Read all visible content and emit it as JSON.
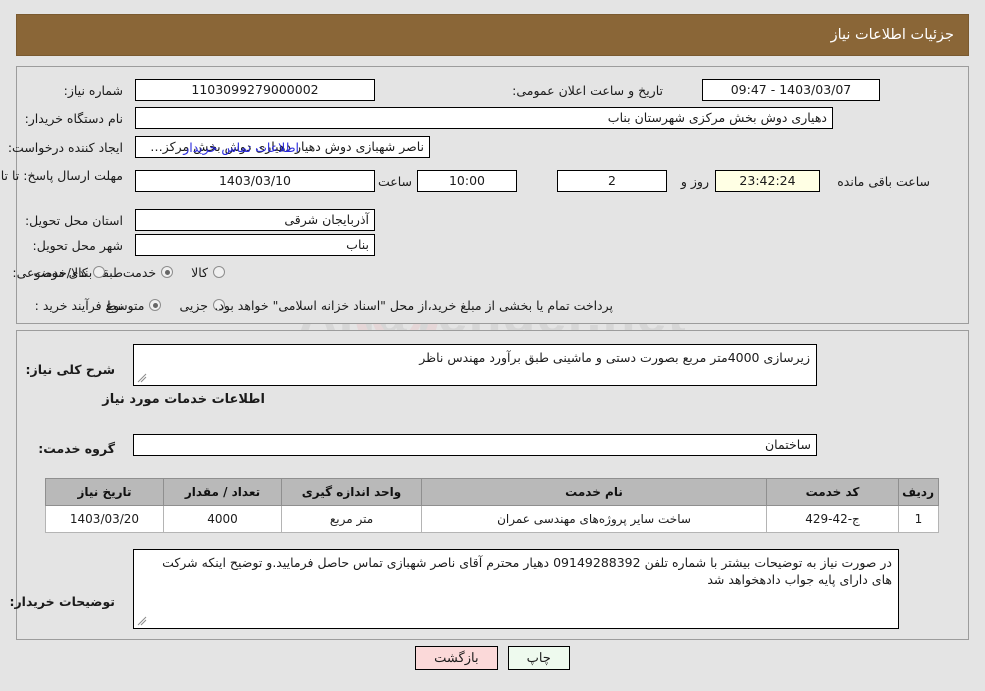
{
  "header": {
    "title": "جزئیات اطلاعات نیاز"
  },
  "watermark": {
    "text": "AriaTender.net",
    "shield_icon": "shield-icon"
  },
  "info": {
    "need_number_label": "شماره نیاز:",
    "need_number_value": "1103099279000002",
    "announce_datetime_label": "تاریخ و ساعت اعلان عمومی:",
    "announce_datetime_value": "1403/03/07 - 09:47",
    "buyer_org_label": "نام دستگاه خریدار:",
    "buyer_org_value": "دهیاری دوش بخش مرکزی شهرستان بناب",
    "requester_label": "ایجاد کننده درخواست:",
    "requester_value": "ناصر شهبازی دوش دهیار دهیاری دوش بخش مرکزی شهرستان بناب",
    "contact_link": "اطلاعات تماس خریدار",
    "deadline_label": "مهلت ارسال پاسخ: تا تاریخ:",
    "deadline_date": "1403/03/10",
    "deadline_hour_label": "ساعت",
    "deadline_hour": "10:00",
    "days_remaining": "2",
    "days_and_label": "روز و",
    "countdown": "23:42:24",
    "remaining_label": "ساعت باقی مانده",
    "province_label": "استان محل تحویل:",
    "province_value": "آذربایجان شرقی",
    "city_label": "شهر محل تحویل:",
    "city_value": "بناب",
    "category_label": "طبقه بندی موضوعی:",
    "category_options": [
      {
        "label": "کالا",
        "selected": false
      },
      {
        "label": "خدمت",
        "selected": true
      },
      {
        "label": "کالا/خدمت",
        "selected": false
      }
    ],
    "process_label": "نوع فرآیند خرید :",
    "process_options": [
      {
        "label": "جزیی",
        "selected": false
      },
      {
        "label": "متوسط",
        "selected": true
      }
    ],
    "process_note": "پرداخت تمام یا بخشی از مبلغ خرید،از محل \"اسناد خزانه اسلامی\" خواهد بود."
  },
  "description": {
    "label": "شرح کلی نیاز:",
    "value": "زیرسازی 4000متر مربع بصورت دستی و ماشینی طبق برآورد مهندس ناظر"
  },
  "services_section": {
    "heading": "اطلاعات خدمات مورد نیاز",
    "group_label": "گروه خدمت:",
    "group_value": "ساختمان"
  },
  "table": {
    "columns": [
      "ردیف",
      "کد خدمت",
      "نام خدمت",
      "واحد اندازه گیری",
      "تعداد / مقدار",
      "تاریخ نیاز"
    ],
    "rows": [
      {
        "row_no": "1",
        "service_code": "ج-42-429",
        "service_name": "ساخت سایر پروژه‌های مهندسی عمران",
        "unit": "متر مربع",
        "quantity": "4000",
        "need_date": "1403/03/20"
      }
    ]
  },
  "buyer_notes": {
    "label": "توضیحات خریدار:",
    "value": "در صورت نیاز به توضیحات بیشتر با شماره تلفن 09149288392 دهیار محترم آقای ناصر شهبازی تماس حاصل فرمایید.و توضیح اینکه شرکت های دارای پایه جواب دادهخواهد شد"
  },
  "footer": {
    "print_label": "چاپ",
    "back_label": "بازگشت"
  },
  "colors": {
    "header_band": "#8a6637",
    "page_bg": "#e4e4e4",
    "link": "#2b2bdd",
    "table_header": "#b9b9b9",
    "countdown_bg": "#ffffe4",
    "btn_print_bg": "#eefaee",
    "btn_back_bg": "#fbd9d9"
  }
}
